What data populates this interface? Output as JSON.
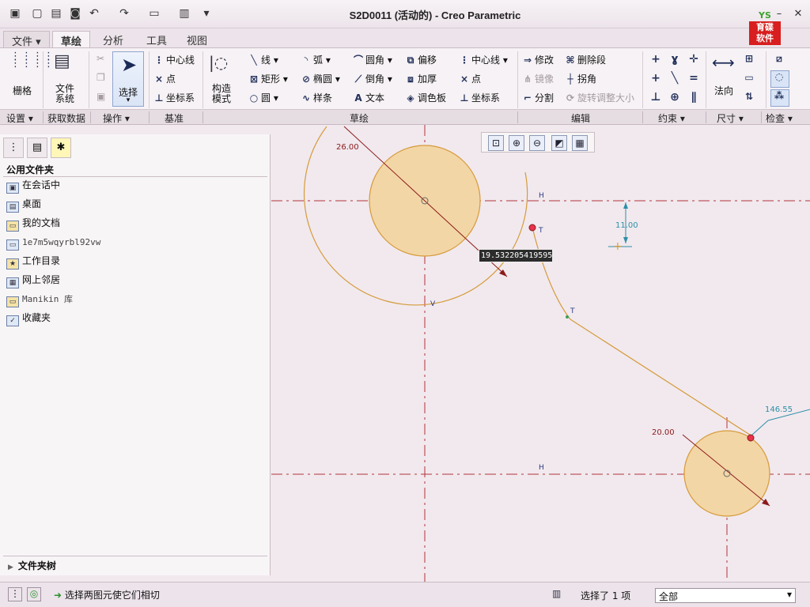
{
  "window": {
    "title": "S2D0011 (活动的) - Creo Parametric"
  },
  "logo": {
    "text_top": "YS",
    "text_line1": "育碟",
    "text_line2": "软件"
  },
  "menu_tabs": [
    {
      "label": "文件 ▾"
    },
    {
      "label": "草绘"
    },
    {
      "label": "分析"
    },
    {
      "label": "工具"
    },
    {
      "label": "视图"
    }
  ],
  "ribbon": {
    "grid": "栅格",
    "file_system": [
      "文件",
      "系统"
    ],
    "select": "选择",
    "datum": {
      "centerline": "中心线",
      "point": "点",
      "csys": "坐标系"
    },
    "construction_mode": [
      "构造",
      "模式"
    ],
    "sketch": {
      "line": "线",
      "rectangle": "矩形",
      "circle": "圆",
      "arc": "弧",
      "ellipse": "椭圆",
      "spline": "样条",
      "fillet": "圆角",
      "chamfer": "倒角",
      "text": "文本",
      "offset": "偏移",
      "thicken": "加厚",
      "palette": "调色板",
      "centerline": "中心线",
      "point": "点",
      "csys": "坐标系"
    },
    "edit": {
      "modify": "修改",
      "delete_segment": "删除段",
      "mirror": "镜像",
      "corner": "拐角",
      "divide": "分割",
      "rotate_resize": "旋转调整大小"
    },
    "normal": "法向"
  },
  "groups": [
    "设置 ▾",
    "获取数据",
    "操作 ▾",
    "基准",
    "草绘",
    "编辑",
    "约束 ▾",
    "尺寸 ▾",
    "检查 ▾"
  ],
  "panel": {
    "header": "公用文件夹",
    "items": [
      {
        "label": "在会话中",
        "icon": "session-icon"
      },
      {
        "label": "桌面",
        "icon": "desktop-icon"
      },
      {
        "label": "我的文档",
        "icon": "documents-icon"
      },
      {
        "label": "1e7m5wqyrbl92vw",
        "icon": "computer-icon"
      },
      {
        "label": "工作目录",
        "icon": "working-dir-icon"
      },
      {
        "label": "网上邻居",
        "icon": "network-icon"
      },
      {
        "label": "Manikin 库",
        "icon": "library-icon"
      },
      {
        "label": "收藏夹",
        "icon": "favorites-icon"
      }
    ],
    "folder_tree": "文件夹树"
  },
  "canvas": {
    "dim_large_circle": "26.00",
    "dim_small_circle": "20.00",
    "dim_vertical": "11.00",
    "dim_distance": "146.55",
    "dim_tooltip": "19.532205419595",
    "label_h1": "H",
    "label_h2": "H",
    "label_t1": "T",
    "label_t2": "T",
    "label_v": "V"
  },
  "status": {
    "message": "选择两图元使它们相切",
    "selected": "选择了 1 项",
    "filter": "全部"
  }
}
